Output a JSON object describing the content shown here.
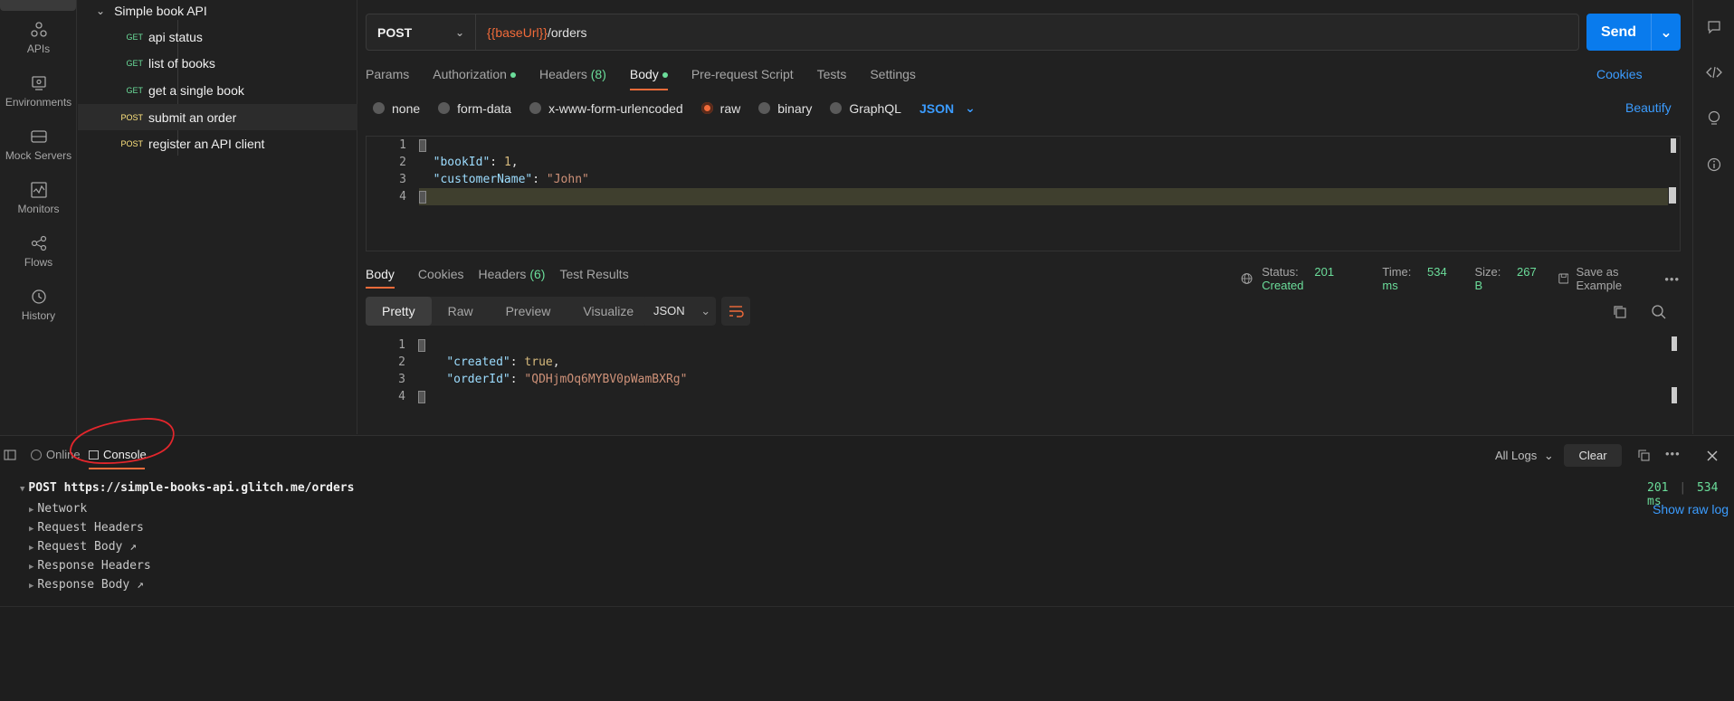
{
  "rail": {
    "items": [
      {
        "label": "APIs",
        "icon": "api-icon"
      },
      {
        "label": "Environments",
        "icon": "environments-icon"
      },
      {
        "label": "Mock Servers",
        "icon": "mock-servers-icon"
      },
      {
        "label": "Monitors",
        "icon": "monitors-icon"
      },
      {
        "label": "Flows",
        "icon": "flows-icon"
      },
      {
        "label": "History",
        "icon": "history-icon"
      }
    ]
  },
  "sidebar": {
    "collection": "Simple book API",
    "requests": [
      {
        "method": "GET",
        "name": "api status"
      },
      {
        "method": "GET",
        "name": "list of books"
      },
      {
        "method": "GET",
        "name": "get a single book"
      },
      {
        "method": "POST",
        "name": "submit an order"
      },
      {
        "method": "POST",
        "name": "register an API client"
      }
    ]
  },
  "request": {
    "method": "POST",
    "url_var": "{{baseUrl}}",
    "url_path": "/orders",
    "send_label": "Send",
    "tabs": {
      "params": "Params",
      "authorization": "Authorization",
      "headers": "Headers",
      "headers_count": "(8)",
      "body": "Body",
      "prerequest": "Pre-request Script",
      "tests": "Tests",
      "settings": "Settings"
    },
    "cookies_link": "Cookies",
    "body_types": {
      "none": "none",
      "form_data": "form-data",
      "urlencoded": "x-www-form-urlencoded",
      "raw": "raw",
      "binary": "binary",
      "graphql": "GraphQL"
    },
    "raw_format": "JSON",
    "beautify_link": "Beautify",
    "body_lines": {
      "l1": "1",
      "l2": "2",
      "l3": "3",
      "l4": "4",
      "key1": "\"bookId\"",
      "val1": "1",
      "key2": "\"customerName\"",
      "val2": "\"John\""
    }
  },
  "response": {
    "tabs": {
      "body": "Body",
      "cookies": "Cookies",
      "headers": "Headers",
      "headers_count": "(6)",
      "test_results": "Test Results"
    },
    "status_label": "Status:",
    "status_value": "201 Created",
    "time_label": "Time:",
    "time_value": "534 ms",
    "size_label": "Size:",
    "size_value": "267 B",
    "save_example": "Save as Example",
    "formats": {
      "pretty": "Pretty",
      "raw": "Raw",
      "preview": "Preview",
      "visualize": "Visualize"
    },
    "format_type": "JSON",
    "body_lines": {
      "l1": "1",
      "l2": "2",
      "l3": "3",
      "l4": "4",
      "key1": "\"created\"",
      "val1": "true",
      "key2": "\"orderId\"",
      "val2": "\"QDHjmOq6MYBV0pWamBXRg\""
    }
  },
  "console": {
    "online_label": "Online",
    "console_label": "Console",
    "all_logs": "All Logs",
    "clear_label": "Clear",
    "entry": {
      "method": "POST",
      "url": "https://simple-books-api.glitch.me/orders",
      "status": "201",
      "time": "534 ms",
      "show_raw": "Show raw log",
      "sections": [
        "Network",
        "Request Headers",
        "Request Body ↗",
        "Response Headers",
        "Response Body ↗"
      ]
    }
  },
  "colors": {
    "accent_orange": "#f26b3a",
    "send_blue": "#097bed",
    "link_blue": "#3b9cff",
    "green": "#6bdd9a",
    "post_yellow": "#ffe47e",
    "annotation_red": "#e3262c"
  }
}
